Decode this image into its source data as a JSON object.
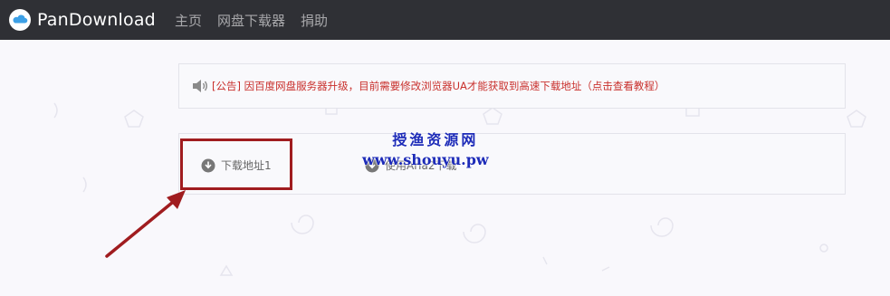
{
  "navbar": {
    "brand": "PanDownload",
    "links": [
      "主页",
      "网盘下载器",
      "捐助"
    ]
  },
  "notice": {
    "icon": "speaker-icon",
    "text": "[公告] 因百度网盘服务器升级，目前需要修改浏览器UA才能获取到高速下载地址（点击查看教程）"
  },
  "downloads": {
    "button1_label": "下载地址1",
    "button2_label": "使用Aria2下载",
    "icon": "download-circle-icon"
  },
  "watermark": {
    "title": "授渔资源网",
    "url": "www.shouyu.pw"
  },
  "colors": {
    "navbar": "#2f3035",
    "notice_text": "#c9302c",
    "highlight": "#a01c1f",
    "watermark": "#1d2bb8"
  }
}
